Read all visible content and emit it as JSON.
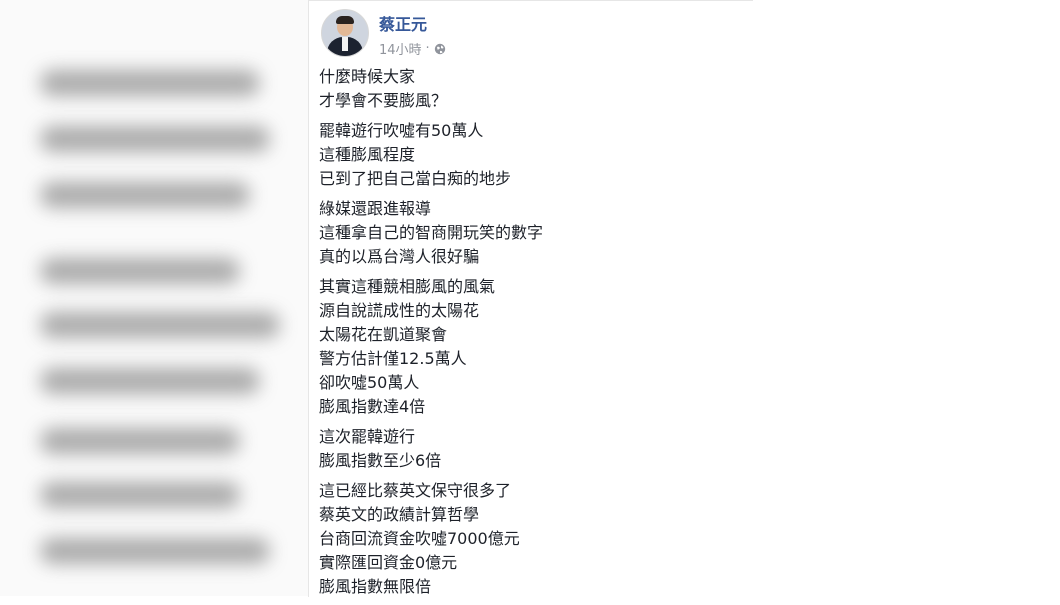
{
  "post": {
    "author": "蔡正元",
    "time": "14小時",
    "privacy_icon": "globe-icon",
    "paragraphs": [
      [
        "什麼時候大家",
        "才學會不要膨風？"
      ],
      [
        "罷韓遊行吹噓有50萬人",
        "這種膨風程度",
        "已到了把自己當白痴的地步"
      ],
      [
        "綠媒還跟進報導",
        "這種拿自己的智商開玩笑的數字",
        "真的以爲台灣人很好騙"
      ],
      [
        "其實這種競相膨風的風氣",
        "源自說謊成性的太陽花",
        "太陽花在凱道聚會",
        "警方估計僅12.5萬人",
        "卻吹噓50萬人",
        "膨風指數達4倍"
      ],
      [
        "這次罷韓遊行",
        "膨風指數至少6倍"
      ],
      [
        "這已經比蔡英文保守很多了",
        "蔡英文的政績計算哲學",
        "台商回流資金吹噓7000億元",
        "實際匯回資金0億元",
        "膨風指數無限倍"
      ]
    ]
  },
  "colors": {
    "author_link": "#365899",
    "meta": "#90949c",
    "text": "#1d2129"
  }
}
